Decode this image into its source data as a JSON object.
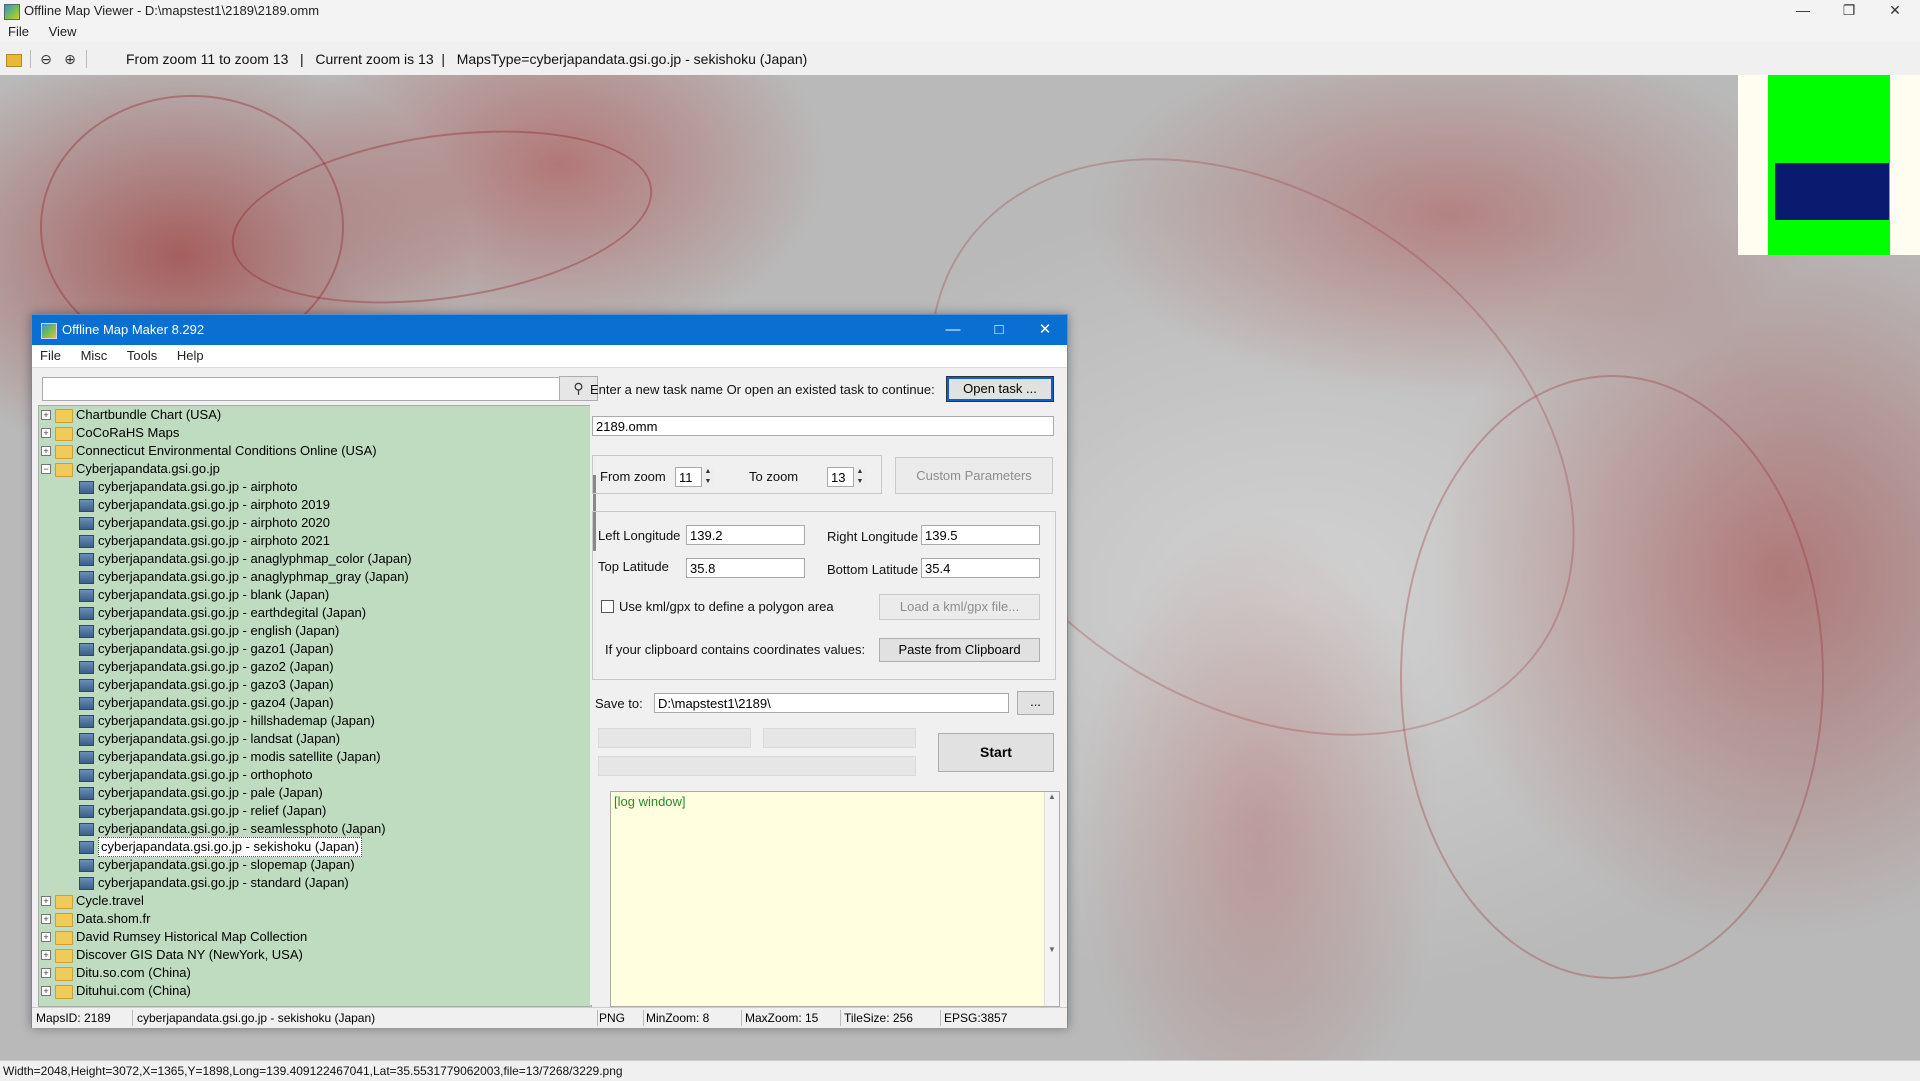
{
  "window": {
    "title": "Offline Map Viewer - D:\\mapstest1\\2189\\2189.omm",
    "menu": [
      "File",
      "View"
    ]
  },
  "toolbar": {
    "status": "From zoom 11 to zoom 13   |   Current zoom is 13  |   MapsType=cyberjapandata.gsi.go.jp - sekishoku (Japan)"
  },
  "statusbar": {
    "text": "Width=2048,Height=3072,X=1365,Y=1898,Long=139.409122467041,Lat=35.5531779062003,file=13/7268/3229.png"
  },
  "dialog": {
    "title": "Offline Map Maker 8.292",
    "menu": [
      "File",
      "Misc",
      "Tools",
      "Help"
    ],
    "search": {
      "value": "",
      "placeholder": ""
    },
    "tree": [
      {
        "label": "Chartbundle Chart (USA)",
        "type": "folder",
        "expanded": false
      },
      {
        "label": "CoCoRaHS Maps",
        "type": "folder",
        "expanded": false
      },
      {
        "label": "Connecticut Environmental Conditions Online (USA)",
        "type": "folder",
        "expanded": false
      },
      {
        "label": "Cyberjapandata.gsi.go.jp",
        "type": "folder",
        "expanded": true
      },
      {
        "label": "cyberjapandata.gsi.go.jp - airphoto",
        "type": "map"
      },
      {
        "label": "cyberjapandata.gsi.go.jp - airphoto 2019",
        "type": "map"
      },
      {
        "label": "cyberjapandata.gsi.go.jp - airphoto 2020",
        "type": "map"
      },
      {
        "label": "cyberjapandata.gsi.go.jp - airphoto 2021",
        "type": "map"
      },
      {
        "label": "cyberjapandata.gsi.go.jp - anaglyphmap_color (Japan)",
        "type": "map"
      },
      {
        "label": "cyberjapandata.gsi.go.jp - anaglyphmap_gray (Japan)",
        "type": "map"
      },
      {
        "label": "cyberjapandata.gsi.go.jp - blank (Japan)",
        "type": "map"
      },
      {
        "label": "cyberjapandata.gsi.go.jp - earthdegital (Japan)",
        "type": "map"
      },
      {
        "label": "cyberjapandata.gsi.go.jp - english (Japan)",
        "type": "map"
      },
      {
        "label": "cyberjapandata.gsi.go.jp - gazo1 (Japan)",
        "type": "map"
      },
      {
        "label": "cyberjapandata.gsi.go.jp - gazo2 (Japan)",
        "type": "map"
      },
      {
        "label": "cyberjapandata.gsi.go.jp - gazo3 (Japan)",
        "type": "map"
      },
      {
        "label": "cyberjapandata.gsi.go.jp - gazo4 (Japan)",
        "type": "map"
      },
      {
        "label": "cyberjapandata.gsi.go.jp - hillshademap (Japan)",
        "type": "map"
      },
      {
        "label": "cyberjapandata.gsi.go.jp - landsat (Japan)",
        "type": "map"
      },
      {
        "label": "cyberjapandata.gsi.go.jp - modis satellite (Japan)",
        "type": "map"
      },
      {
        "label": "cyberjapandata.gsi.go.jp - orthophoto",
        "type": "map"
      },
      {
        "label": "cyberjapandata.gsi.go.jp - pale (Japan)",
        "type": "map"
      },
      {
        "label": "cyberjapandata.gsi.go.jp - relief (Japan)",
        "type": "map"
      },
      {
        "label": "cyberjapandata.gsi.go.jp - seamlessphoto (Japan)",
        "type": "map"
      },
      {
        "label": "cyberjapandata.gsi.go.jp - sekishoku (Japan)",
        "type": "map",
        "selected": true
      },
      {
        "label": "cyberjapandata.gsi.go.jp - slopemap (Japan)",
        "type": "map"
      },
      {
        "label": "cyberjapandata.gsi.go.jp - standard (Japan)",
        "type": "map"
      },
      {
        "label": "Cycle.travel",
        "type": "folder",
        "expanded": false
      },
      {
        "label": "Data.shom.fr",
        "type": "folder",
        "expanded": false
      },
      {
        "label": "David Rumsey Historical Map Collection",
        "type": "folder",
        "expanded": false
      },
      {
        "label": "Discover GIS Data NY (NewYork, USA)",
        "type": "folder",
        "expanded": false
      },
      {
        "label": "Ditu.so.com (China)",
        "type": "folder",
        "expanded": false
      },
      {
        "label": "Dituhui.com (China)",
        "type": "folder",
        "expanded": false
      }
    ],
    "task": {
      "prompt": "Enter a new task name Or open an existed task to continue:",
      "open_label": "Open task ...",
      "name_value": "2189.omm"
    },
    "zoom": {
      "from_label": "From zoom",
      "from_value": "11",
      "to_label": "To zoom",
      "to_value": "13",
      "custom_label": "Custom Parameters"
    },
    "coords": {
      "left_lon_label": "Left Longitude",
      "left_lon_value": "139.2",
      "right_lon_label": "Right Longitude",
      "right_lon_value": "139.5",
      "top_lat_label": "Top Latitude",
      "top_lat_value": "35.8",
      "bottom_lat_label": "Bottom Latitude",
      "bottom_lat_value": "35.4",
      "kml_label": "Use kml/gpx to define a polygon area",
      "kml_checked": false,
      "kml_button": "Load a kml/gpx file...",
      "clipboard_label": "If your clipboard contains coordinates values:",
      "clipboard_button": "Paste from Clipboard"
    },
    "save": {
      "label": "Save to:",
      "value": "D:\\mapstest1\\2189\\",
      "browse_label": "...",
      "start_label": "Start"
    },
    "log": {
      "text": "[log window]"
    },
    "status": {
      "maps_id": "MapsID: 2189",
      "map_name": "cyberjapandata.gsi.go.jp - sekishoku (Japan)",
      "format": "PNG",
      "min_zoom": "MinZoom: 8",
      "max_zoom": "MaxZoom: 15",
      "tile_size": "TileSize: 256",
      "epsg": "EPSG:3857"
    }
  },
  "colors": {
    "dialog_titlebar": "#0a6fd3",
    "tree_background": "#c0dcc0",
    "log_background": "#ffffdf",
    "minimap_green": "#00ff00",
    "minimap_blue": "#0a1a6e",
    "map_relief": "#a03030"
  }
}
